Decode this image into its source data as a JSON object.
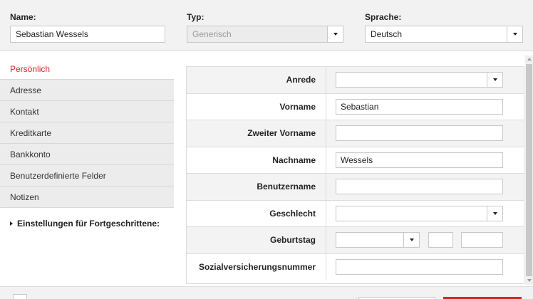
{
  "header": {
    "name_label": "Name:",
    "name_value": "Sebastian Wessels",
    "type_label": "Typ:",
    "type_value": "Generisch",
    "lang_label": "Sprache:",
    "lang_value": "Deutsch"
  },
  "nav": {
    "items": [
      {
        "label": "Persönlich"
      },
      {
        "label": "Adresse"
      },
      {
        "label": "Kontakt"
      },
      {
        "label": "Kreditkarte"
      },
      {
        "label": "Bankkonto"
      },
      {
        "label": "Benutzerdefinierte Felder"
      },
      {
        "label": "Notizen"
      }
    ],
    "advanced": "Einstellungen für Fortgeschrittene:"
  },
  "form": {
    "anrede": {
      "label": "Anrede",
      "value": ""
    },
    "vorname": {
      "label": "Vorname",
      "value": "Sebastian"
    },
    "zweiter": {
      "label": "Zweiter Vorname",
      "value": ""
    },
    "nachname": {
      "label": "Nachname",
      "value": "Wessels"
    },
    "benutzer": {
      "label": "Benutzername",
      "value": ""
    },
    "geschlecht": {
      "label": "Geschlecht",
      "value": ""
    },
    "geburtstag": {
      "label": "Geburtstag",
      "month": "",
      "day": "",
      "year": ""
    },
    "sozial": {
      "label": "Sozialversicherungsnummer",
      "value": ""
    }
  },
  "colors": {
    "accent": "#d8232a"
  }
}
